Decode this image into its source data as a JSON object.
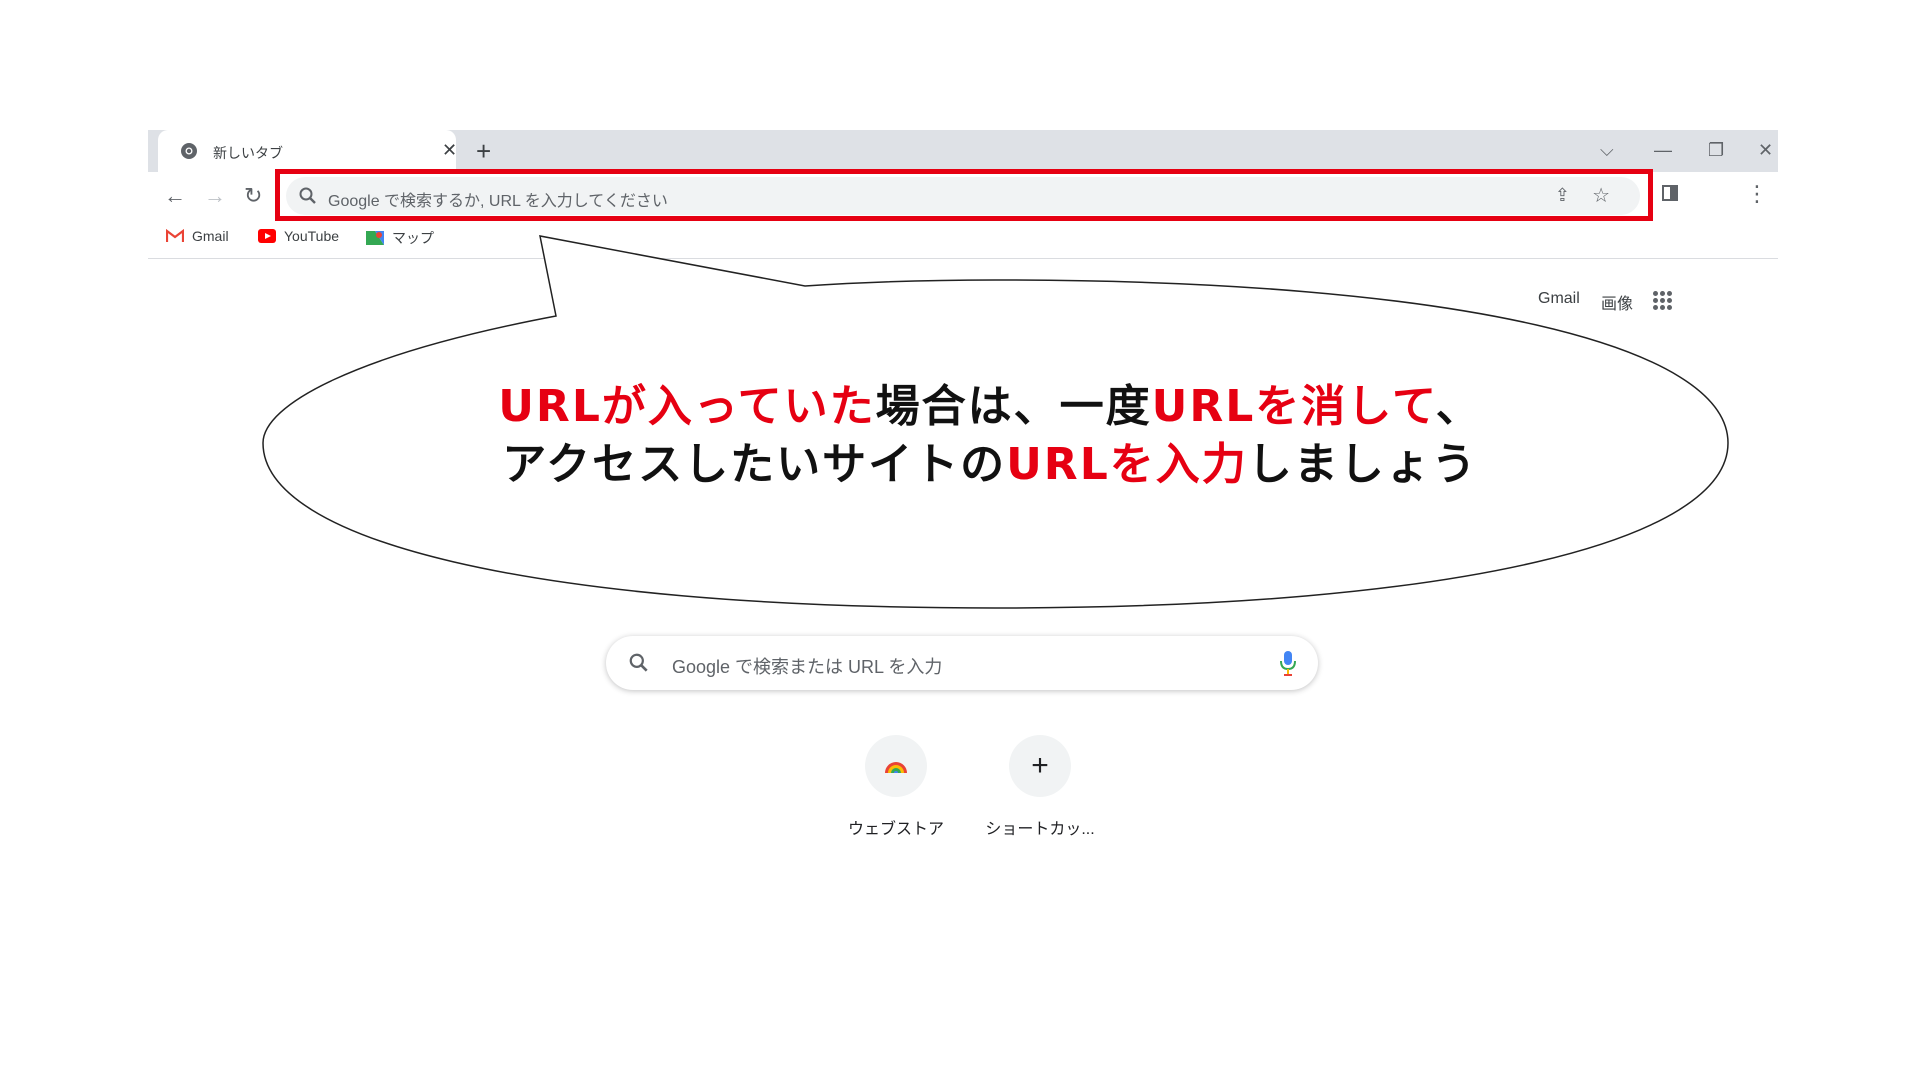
{
  "tab": {
    "title": "新しいタブ",
    "close": "✕"
  },
  "tabstrip": {
    "new_tab": "+",
    "list": "⌵",
    "minimize": "—",
    "restore": "❐",
    "close": "✕"
  },
  "toolbar": {
    "back": "←",
    "forward": "→",
    "reload": "↻",
    "share": "⇪",
    "bookmark": "☆",
    "menu": "⋮"
  },
  "omnibox": {
    "placeholder": "Google で検索するか, URL を入力してください"
  },
  "bookmarks": [
    {
      "label": "Gmail",
      "icon": "gmail-icon"
    },
    {
      "label": "YouTube",
      "icon": "youtube-icon"
    },
    {
      "label": "マップ",
      "icon": "maps-icon"
    }
  ],
  "google_bar": {
    "gmail": "Gmail",
    "images": "画像"
  },
  "callout": {
    "line1": [
      {
        "text": "URLが入っていた",
        "red": true
      },
      {
        "text": "場合は、一度",
        "red": false
      },
      {
        "text": "URLを消して",
        "red": true
      },
      {
        "text": "、",
        "red": false
      }
    ],
    "line2": [
      {
        "text": "アクセスしたいサイトの",
        "red": false
      },
      {
        "text": "URLを入力",
        "red": true
      },
      {
        "text": "しましょう",
        "red": false
      }
    ]
  },
  "search": {
    "placeholder": "Google で検索または URL を入力"
  },
  "shortcuts": [
    {
      "label": "ウェブストア",
      "icon": "webstore-icon"
    },
    {
      "label": "ショートカッ...",
      "icon": "+"
    }
  ],
  "colors": {
    "highlight": "#e60012",
    "tabstrip": "#dee1e6",
    "omnibox": "#f1f3f4"
  }
}
